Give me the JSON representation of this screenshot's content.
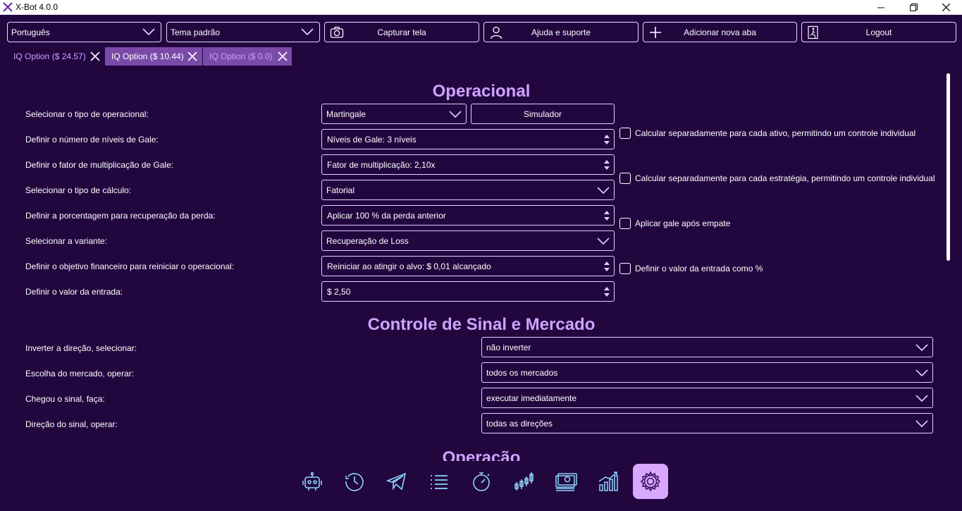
{
  "window": {
    "title": "X-Bot 4.0.0"
  },
  "toolbar": {
    "language": "Português",
    "theme": "Tema padrão",
    "capture": "Capturar tela",
    "help": "Ajuda e suporte",
    "add_tab": "Adicionar nova aba",
    "logout": "Logout"
  },
  "tabs": [
    {
      "label": "IQ Option ($ 24.57)"
    },
    {
      "label": "IQ Option ($ 10.44)"
    },
    {
      "label": "IQ Option ($ 0.0)"
    }
  ],
  "operacional": {
    "title": "Operacional",
    "rows": [
      {
        "label": "Selecionar o tipo de operacional:",
        "value": "Martingale"
      },
      {
        "label": "Definir o número de níveis de Gale:",
        "value": "Níveis de Gale: 3 níveis"
      },
      {
        "label": "Definir o fator de multiplicação de Gale:",
        "value": "Fator de multiplicação: 2,10x"
      },
      {
        "label": "Selecionar o tipo de cálculo:",
        "value": "Fatorial"
      },
      {
        "label": "Definir a porcentagem para recuperação da perda:",
        "value": "Aplicar 100 % da perda anterior"
      },
      {
        "label": "Selecionar a variante:",
        "value": "Recuperação de Loss"
      },
      {
        "label": "Definir o objetivo financeiro para reiniciar o operacional:",
        "value": "Reiniciar ao atingir o alvo: $ 0,01 alcançado"
      },
      {
        "label": "Definir o valor da entrada:",
        "value": "$ 2,50"
      }
    ],
    "simulator": "Simulador",
    "checkboxes": [
      {
        "label": "Calcular separadamente para cada ativo, permitindo um controle individual",
        "checked": false
      },
      {
        "label": "Calcular separadamente para cada estratégia, permitindo um controle individual",
        "checked": false
      },
      {
        "label": "Aplicar gale após empate",
        "checked": false
      },
      {
        "label": "Definir o valor da entrada como %",
        "checked": false
      }
    ]
  },
  "sinal": {
    "title": "Controle de Sinal e Mercado",
    "rows": [
      {
        "label": "Inverter a direção, selecionar:",
        "value": "não inverter"
      },
      {
        "label": "Escolha do mercado, operar:",
        "value": "todos os mercados"
      },
      {
        "label": "Chegou o sinal, faça:",
        "value": "executar imediatamente"
      },
      {
        "label": "Direção do sinal, operar:",
        "value": "todas as direções"
      }
    ]
  },
  "operacao": {
    "title": "Operação"
  },
  "nav": {
    "icons": [
      "robot-icon",
      "history-icon",
      "telegram-icon",
      "list-icon",
      "timer-icon",
      "candlestick-icon",
      "money-icon",
      "growth-chart-icon",
      "settings-gear-icon"
    ],
    "active": "settings-gear-icon"
  },
  "colors": {
    "background": "#22073f",
    "accent": "#cfa3ff",
    "active_tab": "#7a4aa8",
    "nav_active": "#d8a8ff",
    "nav_icon": "#8fd6ff"
  }
}
